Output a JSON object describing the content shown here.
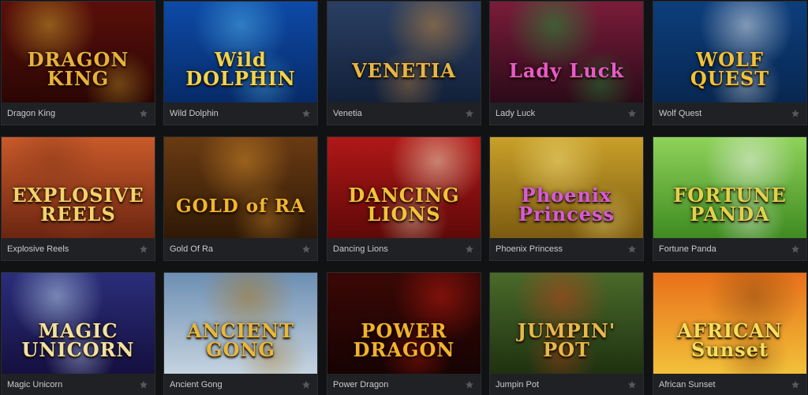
{
  "games": [
    {
      "name": "Dragon King",
      "logo_lines": [
        "DRAGON",
        "KING"
      ],
      "logo_color": "#e8b23a",
      "bg_top": "#5a0f0a",
      "bg_bottom": "#2a0604",
      "accent": "#c9a02a"
    },
    {
      "name": "Wild Dolphin",
      "logo_lines": [
        "Wild",
        "DOLPHIN"
      ],
      "logo_color": "#f2d34a",
      "bg_top": "#0d4aa8",
      "bg_bottom": "#072a66",
      "accent": "#4fb0e8"
    },
    {
      "name": "Venetia",
      "logo_lines": [
        "VENETIA"
      ],
      "logo_color": "#e7b743",
      "bg_top": "#2a3f63",
      "bg_bottom": "#122038",
      "accent": "#c88a3e"
    },
    {
      "name": "Lady Luck",
      "logo_lines": [
        "Lady Luck"
      ],
      "logo_color": "#e85ac7",
      "bg_top": "#7a1c3a",
      "bg_bottom": "#2a0a18",
      "accent": "#1e9a38"
    },
    {
      "name": "Wolf Quest",
      "logo_lines": [
        "WOLF",
        "QUEST"
      ],
      "logo_color": "#f0c23a",
      "bg_top": "#0c3e7c",
      "bg_bottom": "#082750",
      "accent": "#e8edf2"
    },
    {
      "name": "Explosive Reels",
      "logo_lines": [
        "EXPLOSIVE",
        "REELS"
      ],
      "logo_color": "#f3d36a",
      "bg_top": "#c95a2a",
      "bg_bottom": "#6a2410",
      "accent": "#8a3a1a"
    },
    {
      "name": "Gold Of Ra",
      "logo_lines": [
        "GOLD of RA"
      ],
      "logo_color": "#f2b52e",
      "bg_top": "#6a3b12",
      "bg_bottom": "#2e1806",
      "accent": "#d08a2a"
    },
    {
      "name": "Dancing Lions",
      "logo_lines": [
        "DANCING",
        "LIONS"
      ],
      "logo_color": "#f2c23a",
      "bg_top": "#b01818",
      "bg_bottom": "#5e0808",
      "accent": "#f3e2c0"
    },
    {
      "name": "Phoenix Princess",
      "logo_lines": [
        "Phoenix",
        "Princess"
      ],
      "logo_color": "#d85ad8",
      "bg_top": "#c9a02a",
      "bg_bottom": "#7a5a10",
      "accent": "#f0dc7a"
    },
    {
      "name": "Fortune Panda",
      "logo_lines": [
        "FORTUNE",
        "PANDA"
      ],
      "logo_color": "#e2d24a",
      "bg_top": "#8ed25a",
      "bg_bottom": "#3e8a20",
      "accent": "#f4f4f4"
    },
    {
      "name": "Magic Unicorn",
      "logo_lines": [
        "MAGIC",
        "UNICORN"
      ],
      "logo_color": "#f3e1a0",
      "bg_top": "#2a2e7a",
      "bg_bottom": "#150f3e",
      "accent": "#c2d8f4"
    },
    {
      "name": "Ancient Gong",
      "logo_lines": [
        "ANCIENT",
        "GONG"
      ],
      "logo_color": "#e8b83a",
      "bg_top": "#6d8fb3",
      "bg_bottom": "#c6d4e0",
      "accent": "#a8761e"
    },
    {
      "name": "Power Dragon",
      "logo_lines": [
        "POWER",
        "DRAGON"
      ],
      "logo_color": "#f2b22a",
      "bg_top": "#3a0806",
      "bg_bottom": "#160302",
      "accent": "#c21a0e"
    },
    {
      "name": "Jumpin Pot",
      "logo_lines": [
        "JUMPIN'",
        "POT"
      ],
      "logo_color": "#e8b84a",
      "bg_top": "#4a6a2a",
      "bg_bottom": "#1e3010",
      "accent": "#c0401a"
    },
    {
      "name": "African Sunset",
      "logo_lines": [
        "AFRICAN",
        "Sunset"
      ],
      "logo_color": "#f4e05a",
      "bg_top": "#e8701a",
      "bg_bottom": "#f2c23a",
      "accent": "#8a4a12"
    }
  ]
}
